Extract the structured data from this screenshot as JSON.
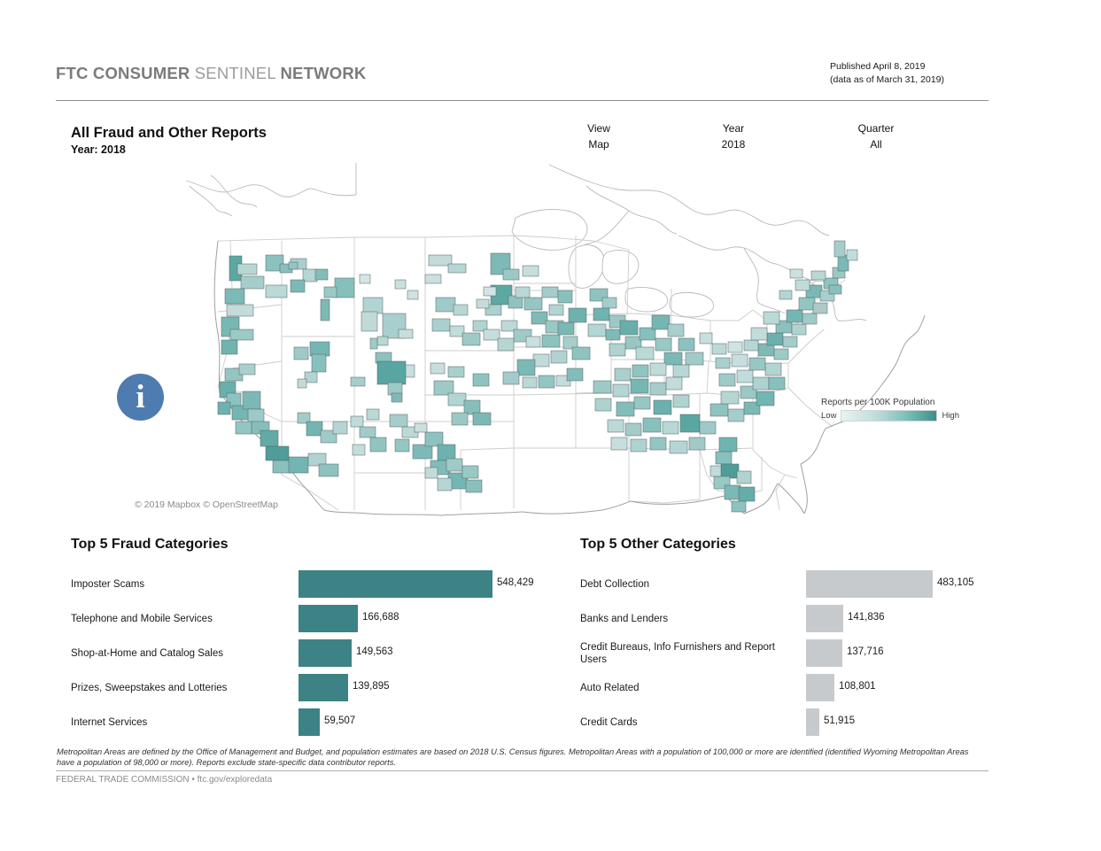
{
  "header": {
    "brand_bold_1": "FTC CONSUMER",
    "brand_light": " SENTINEL ",
    "brand_bold_2": "NETWORK",
    "published_line1": "Published April 8, 2019",
    "published_line2": "(data as of March 31, 2019)"
  },
  "report": {
    "title": "All Fraud and Other Reports",
    "subtitle": "Year: 2018"
  },
  "filters": [
    {
      "label": "View",
      "value": "Map"
    },
    {
      "label": "Year",
      "value": "2018"
    },
    {
      "label": "Quarter",
      "value": "All"
    }
  ],
  "map": {
    "info_icon_glyph": "i",
    "attribution": "© 2019 Mapbox © OpenStreetMap",
    "legend": {
      "caption": "Reports per 100K Population",
      "low_label": "Low",
      "high_label": "High",
      "low_color": "#e9f3f2",
      "high_color": "#3c8f8a"
    }
  },
  "chart_data": [
    {
      "type": "bar",
      "title": "Top 5 Fraud Categories",
      "orientation": "horizontal",
      "xlabel": "",
      "ylabel": "",
      "xlim": [
        0,
        548429
      ],
      "grid": false,
      "legend": "none",
      "color": "#3d8284",
      "categories": [
        "Imposter Scams",
        "Telephone and Mobile Services",
        "Shop-at-Home and Catalog Sales",
        "Prizes, Sweepstakes and Lotteries",
        "Internet Services"
      ],
      "values": [
        548429,
        166688,
        149563,
        139895,
        59507
      ],
      "value_labels": [
        "548,429",
        "166,688",
        "149,563",
        "139,895",
        "59,507"
      ]
    },
    {
      "type": "bar",
      "title": "Top 5 Other Categories",
      "orientation": "horizontal",
      "xlabel": "",
      "ylabel": "",
      "xlim": [
        0,
        483105
      ],
      "grid": false,
      "legend": "none",
      "color": "#c7cacd",
      "categories": [
        "Debt Collection",
        "Banks and Lenders",
        "Credit Bureaus, Info Furnishers and Report Users",
        "Auto Related",
        "Credit Cards"
      ],
      "values": [
        483105,
        141836,
        137716,
        108801,
        51915
      ],
      "value_labels": [
        "483,105",
        "141,836",
        "137,716",
        "108,801",
        "51,915"
      ]
    }
  ],
  "footnote": "Metropolitan Areas are defined by the Office of Management and Budget, and population estimates are based on 2018 U.S. Census figures. Metropolitan Areas with a population of 100,000 or more are identified (identified Wyoming Metropolitan Areas have a population of 98,000 or more). Reports exclude state-specific data contributor reports.",
  "footer": {
    "text": "FEDERAL TRADE COMMISSION • ftc.gov/exploredata"
  }
}
